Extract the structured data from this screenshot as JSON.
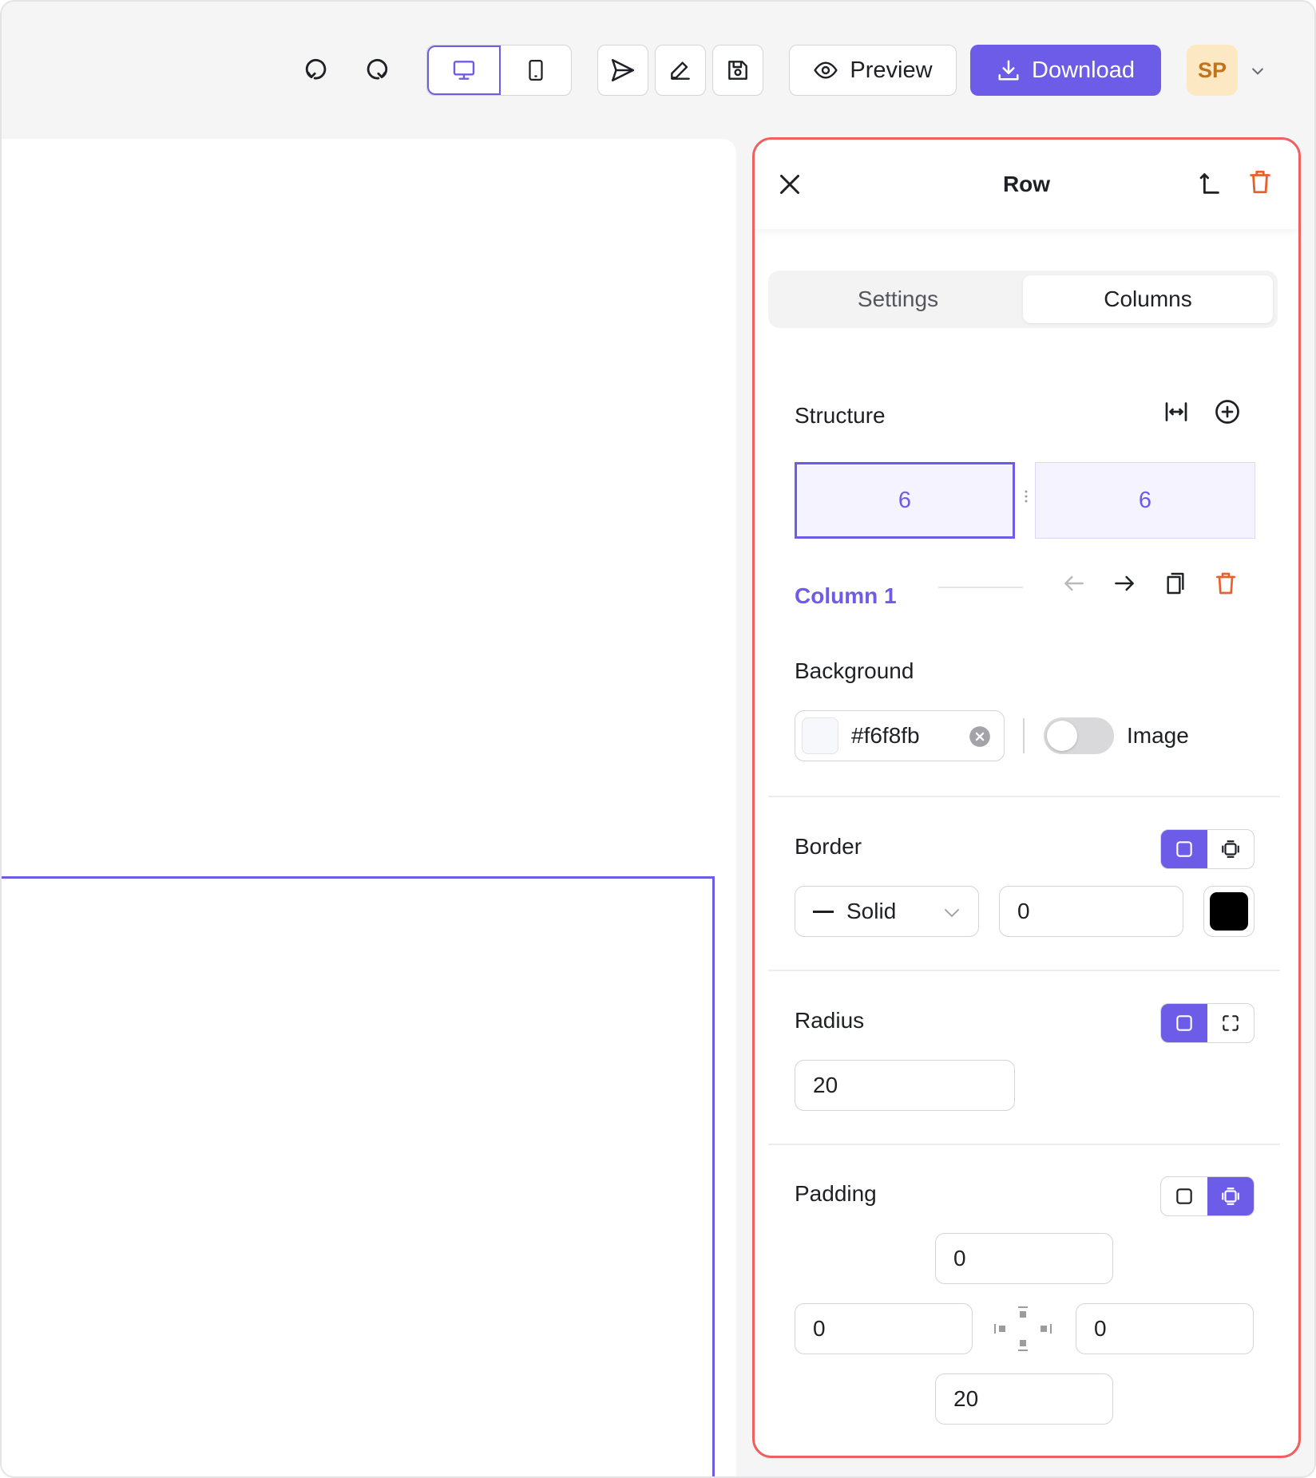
{
  "toolbar": {
    "preview_label": "Preview",
    "download_label": "Download",
    "avatar_initials": "SP"
  },
  "panel": {
    "title": "Row",
    "tabs": [
      {
        "label": "Settings",
        "active": false
      },
      {
        "label": "Columns",
        "active": true
      }
    ],
    "structure": {
      "label": "Structure",
      "columns": [
        "6",
        "6"
      ]
    },
    "column": {
      "label": "Column 1"
    },
    "background": {
      "label": "Background",
      "color_value": "#f6f8fb",
      "image_label": "Image",
      "image_enabled": false
    },
    "border": {
      "label": "Border",
      "style": "Solid",
      "width": "0",
      "color": "#000000"
    },
    "radius": {
      "label": "Radius",
      "value": "20"
    },
    "padding": {
      "label": "Padding",
      "top": "0",
      "left": "0",
      "right": "0",
      "bottom": "20"
    }
  },
  "colors": {
    "accent": "#6c5ce7",
    "danger": "#e8612c",
    "panel_border": "#f25f5f"
  }
}
